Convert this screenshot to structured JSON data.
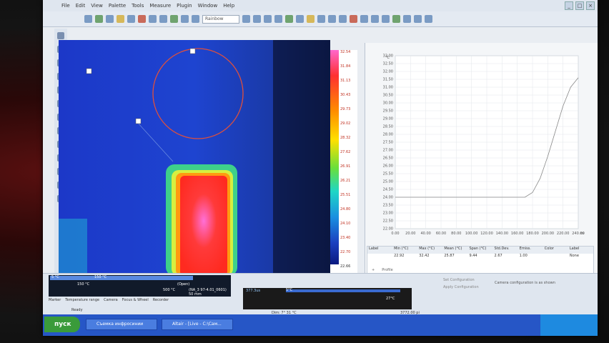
{
  "menu": {
    "items": [
      "File",
      "Edit",
      "View",
      "Palette",
      "Tools",
      "Measure",
      "Plugin",
      "Window",
      "Help"
    ]
  },
  "toolbar": {
    "palette_value": "Rainbow"
  },
  "colorscale": {
    "top": "32.54",
    "bottom": "22.66",
    "ticks": [
      "32.54",
      "31.84",
      "31.13",
      "30.43",
      "29.73",
      "29.02",
      "28.32",
      "27.62",
      "26.91",
      "26.21",
      "25.51",
      "24.80",
      "24.10",
      "23.40",
      "22.70",
      "22.66"
    ],
    "unit": "°C"
  },
  "chart_data": {
    "type": "line",
    "ylabel": "°C",
    "xlabel": "",
    "y_ticks": [
      "33.00",
      "32.50",
      "32.00",
      "31.50",
      "31.00",
      "30.50",
      "30.00",
      "29.50",
      "29.00",
      "28.50",
      "28.00",
      "27.50",
      "27.00",
      "26.50",
      "26.00",
      "25.50",
      "25.00",
      "24.50",
      "24.00",
      "23.50",
      "23.00",
      "22.50",
      "22.00"
    ],
    "x_ticks": [
      "0.00",
      "20.00",
      "40.00",
      "60.00",
      "80.00",
      "100.00",
      "120.00",
      "140.00",
      "160.00",
      "180.00",
      "200.00",
      "220.00",
      "240.00"
    ],
    "x_unit": "m",
    "xlim": [
      0,
      240
    ],
    "ylim": [
      22,
      33
    ],
    "series": [
      {
        "x": [
          0,
          60,
          120,
          170,
          180,
          190,
          200,
          210,
          220,
          230,
          240
        ],
        "y": [
          24,
          24,
          24,
          24,
          24.3,
          25.2,
          26.6,
          28.2,
          29.8,
          31.0,
          31.6
        ]
      }
    ]
  },
  "stats_table": {
    "headers": [
      "Label",
      "Min (°C)",
      "Max (°C)",
      "Mean (°C)",
      "Span (°C)",
      "Std.Dev.",
      "Emiss.",
      "Color",
      "Label"
    ],
    "row": [
      "",
      "22.92",
      "32.42",
      "25.87",
      "9.44",
      "2.67",
      "1.00",
      "",
      "None"
    ]
  },
  "bottom": {
    "range_left": "5 °C",
    "range_mid": "150 °C",
    "range_val": "150 °C",
    "range_open": "(Open)",
    "range_max": "500 °C",
    "lens_info": "(NA_3 97-4.01_0601) 50 mm",
    "lens_mm": "50 mm",
    "tabs": [
      "Marker",
      "Temperature range",
      "Camera",
      "Focus & Wheel",
      "Recorder"
    ],
    "status": "Ready",
    "temp_readout": "5°C",
    "temp_readout2": "27°C",
    "fps_readout": "377.3us",
    "profile_label": "Profile",
    "cam_config": "Set Configuration",
    "apply_config": "Apply Configuration",
    "cam_msg": "Camera configuration is as shown",
    "coords": "Dim: 7° 31 °C",
    "zoom": "3772.00 pi"
  },
  "taskbar": {
    "start": "пуск",
    "items": [
      "Съемка инфросинии",
      "Altair - [Live - C:\\Сам..."
    ]
  }
}
